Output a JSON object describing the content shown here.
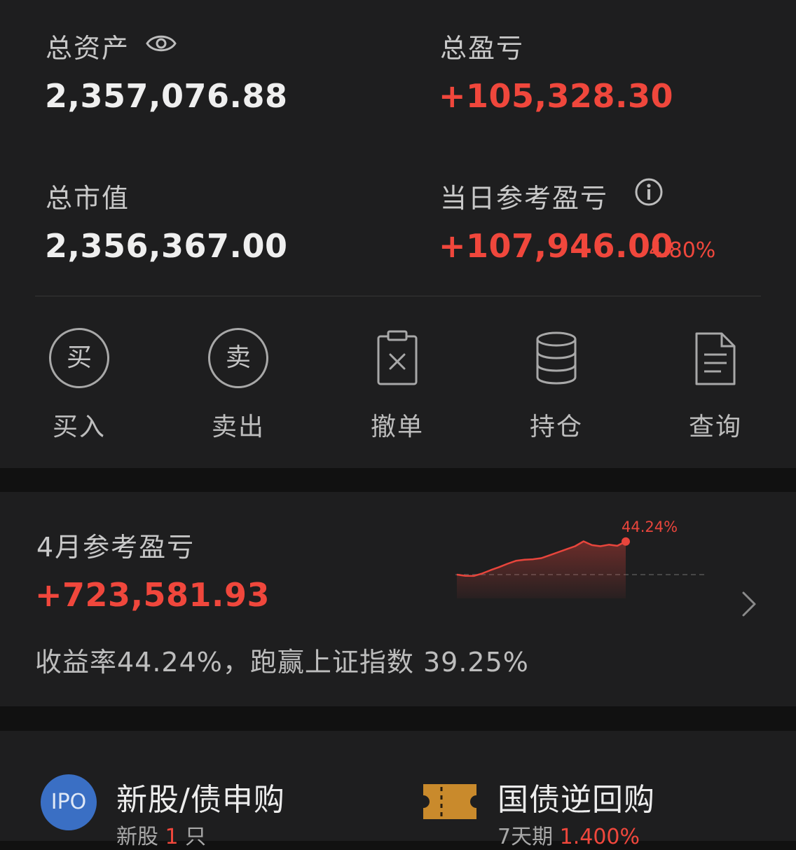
{
  "summary": {
    "total_assets_label": "总资产",
    "total_assets_value": "2,357,076.88",
    "total_pnl_label": "总盈亏",
    "total_pnl_value": "+105,328.30",
    "market_value_label": "总市值",
    "market_value_value": "2,356,367.00",
    "daily_pnl_label": "当日参考盈亏",
    "daily_pnl_value": "+107,946.00",
    "daily_pnl_pct": "4.80%"
  },
  "actions": [
    {
      "label": "买入",
      "icon_char": "买",
      "icon": "buy-icon"
    },
    {
      "label": "卖出",
      "icon_char": "卖",
      "icon": "sell-icon"
    },
    {
      "label": "撤单",
      "icon": "cancel-order-icon"
    },
    {
      "label": "持仓",
      "icon": "positions-icon"
    },
    {
      "label": "查询",
      "icon": "query-document-icon"
    }
  ],
  "monthly": {
    "title": "4月参考盈亏",
    "value": "+723,581.93",
    "summary_text": "收益率44.24%，跑赢上证指数 39.25%",
    "chart_end_label": "44.24%"
  },
  "chart_data": {
    "type": "area",
    "x": [
      1,
      2,
      3,
      4,
      5,
      6,
      7,
      8,
      9,
      10,
      11,
      12,
      13,
      14,
      15,
      16,
      17,
      18,
      19,
      20,
      21
    ],
    "series": [
      {
        "values": [
          0.0,
          -1.6,
          -1.8,
          1.5,
          6.0,
          10.0,
          14.5,
          18.5,
          20.0,
          20.5,
          22.0,
          26.0,
          30.0,
          34.0,
          38.0,
          44.5,
          39.5,
          38.0,
          40.0,
          38.5,
          44.24
        ]
      }
    ],
    "baseline": 0,
    "end_label": "44.24%",
    "colors": {
      "line": "#e8453c",
      "fill": "#e8453c",
      "baseline": "#555555"
    }
  },
  "services": {
    "ipo_title": "新股/债申购",
    "ipo_badge": "IPO",
    "ipo_sub_prefix": "新股 ",
    "ipo_sub_count": "1",
    "ipo_sub_suffix": " 只",
    "repo_title": "国债逆回购",
    "repo_sub_prefix": "7天期 ",
    "repo_sub_rate": "1.400%"
  },
  "colors": {
    "accent_red": "#f0473c",
    "background": "#1e1e1f",
    "gap": "#111111",
    "ipo_blue": "#3a6fc4",
    "ticket_gold": "#c98a2c"
  }
}
